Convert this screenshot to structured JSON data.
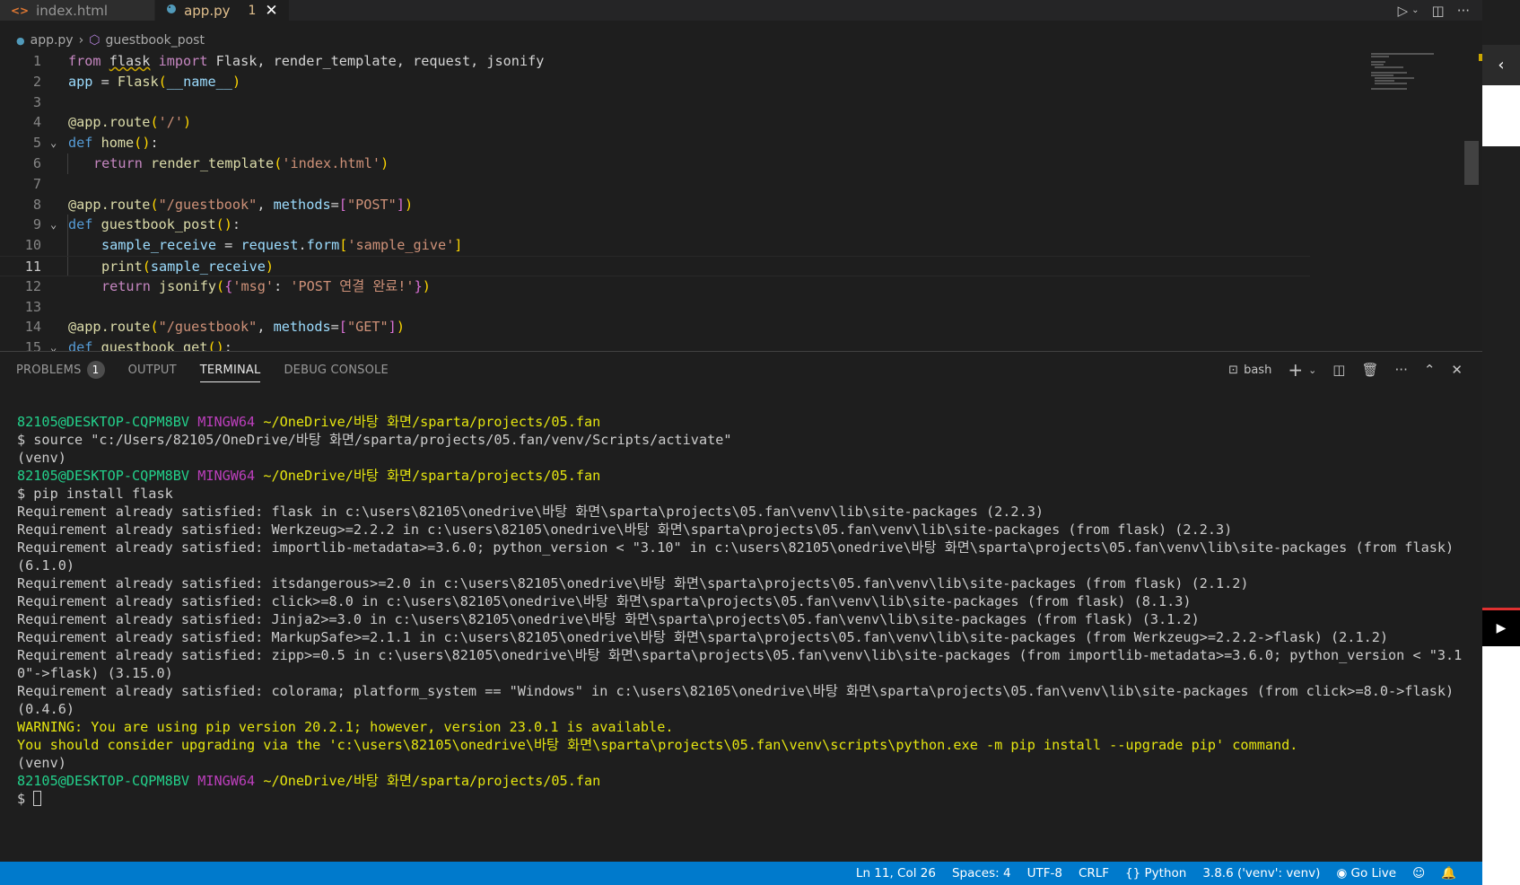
{
  "tabs": [
    {
      "icon": "<>",
      "label": "index.html",
      "active": false
    },
    {
      "icon": "py",
      "label": "app.py",
      "modified_count": "1",
      "active": true
    }
  ],
  "breadcrumb": {
    "file": "app.py",
    "symbol": "guestbook_post"
  },
  "code": {
    "line_numbers": [
      "1",
      "2",
      "3",
      "4",
      "5",
      "6",
      "7",
      "8",
      "9",
      "10",
      "11",
      "12",
      "13",
      "14",
      "15"
    ],
    "current_line": "11"
  },
  "panel": {
    "tabs": [
      "PROBLEMS",
      "OUTPUT",
      "TERMINAL",
      "DEBUG CONSOLE"
    ],
    "problems_count": "1",
    "active_tab": "TERMINAL",
    "shell": "bash"
  },
  "terminal": {
    "prompt_user": "82105@DESKTOP-CQPM8BV",
    "prompt_env": "MINGW64",
    "prompt_path": "~/OneDrive/바탕 화면/sparta/projects/05.fan",
    "lines": [
      "$ source \"c:/Users/82105/OneDrive/바탕 화면/sparta/projects/05.fan/venv/Scripts/activate\"",
      "(venv)",
      "$ pip install flask",
      "Requirement already satisfied: flask in c:\\users\\82105\\onedrive\\바탕 화면\\sparta\\projects\\05.fan\\venv\\lib\\site-packages (2.2.3)",
      "Requirement already satisfied: Werkzeug>=2.2.2 in c:\\users\\82105\\onedrive\\바탕 화면\\sparta\\projects\\05.fan\\venv\\lib\\site-packages (from flask) (2.2.3)",
      "Requirement already satisfied: importlib-metadata>=3.6.0; python_version < \"3.10\" in c:\\users\\82105\\onedrive\\바탕 화면\\sparta\\projects\\05.fan\\venv\\lib\\site-packages (from flask)",
      "(6.1.0)",
      "Requirement already satisfied: itsdangerous>=2.0 in c:\\users\\82105\\onedrive\\바탕 화면\\sparta\\projects\\05.fan\\venv\\lib\\site-packages (from flask) (2.1.2)",
      "Requirement already satisfied: click>=8.0 in c:\\users\\82105\\onedrive\\바탕 화면\\sparta\\projects\\05.fan\\venv\\lib\\site-packages (from flask) (8.1.3)",
      "Requirement already satisfied: Jinja2>=3.0 in c:\\users\\82105\\onedrive\\바탕 화면\\sparta\\projects\\05.fan\\venv\\lib\\site-packages (from flask) (3.1.2)",
      "Requirement already satisfied: MarkupSafe>=2.1.1 in c:\\users\\82105\\onedrive\\바탕 화면\\sparta\\projects\\05.fan\\venv\\lib\\site-packages (from Werkzeug>=2.2.2->flask) (2.1.2)",
      "Requirement already satisfied: zipp>=0.5 in c:\\users\\82105\\onedrive\\바탕 화면\\sparta\\projects\\05.fan\\venv\\lib\\site-packages (from importlib-metadata>=3.6.0; python_version < \"3.1",
      "0\"->flask) (3.15.0)",
      "Requirement already satisfied: colorama; platform_system == \"Windows\" in c:\\users\\82105\\onedrive\\바탕 화면\\sparta\\projects\\05.fan\\venv\\lib\\site-packages (from click>=8.0->flask)",
      "(0.4.6)",
      "WARNING: You are using pip version 20.2.1; however, version 23.0.1 is available.",
      "You should consider upgrading via the 'c:\\users\\82105\\onedrive\\바탕 화면\\sparta\\projects\\05.fan\\venv\\scripts\\python.exe -m pip install --upgrade pip' command.",
      "(venv)",
      "$ "
    ]
  },
  "statusbar": {
    "position": "Ln 11, Col 26",
    "spaces": "Spaces: 4",
    "encoding": "UTF-8",
    "eol": "CRLF",
    "language": "Python",
    "interpreter": "3.8.6 ('venv': venv)",
    "golive": "Go Live"
  },
  "colors": {
    "statusbar": "#007acc",
    "editor_bg": "#1e1e1e",
    "prompt_user": "#23d18b",
    "prompt_env": "#bc3fbc",
    "prompt_path": "#e5e510"
  }
}
